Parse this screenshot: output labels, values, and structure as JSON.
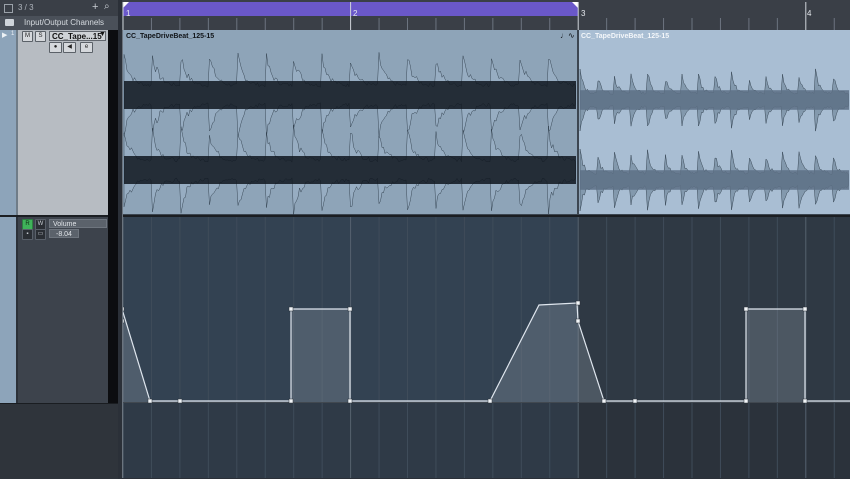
{
  "header": {
    "counter": "3 / 3",
    "folder_label": "Input/Output Channels"
  },
  "audio_track": {
    "name": "CC_Tape...15",
    "buttons": {
      "mute": "M",
      "solo": "S"
    },
    "events": [
      {
        "name": "CC_TapeDriveBeat_125-15",
        "selected": false
      },
      {
        "name": "CC_TapeDriveBeat_125-15",
        "selected": true
      }
    ]
  },
  "automation_track": {
    "parameter": "Volume",
    "value": "-8.04",
    "read_label": "R",
    "write_label": "W"
  },
  "ruler": {
    "bars": [
      "1",
      "2",
      "3",
      "4"
    ]
  },
  "colors": {
    "cycle": "#6a58c9",
    "event_selected": "#a9bed3",
    "event_waveform": "#9fb3c7",
    "automation_line": "#dfe6ee"
  }
}
